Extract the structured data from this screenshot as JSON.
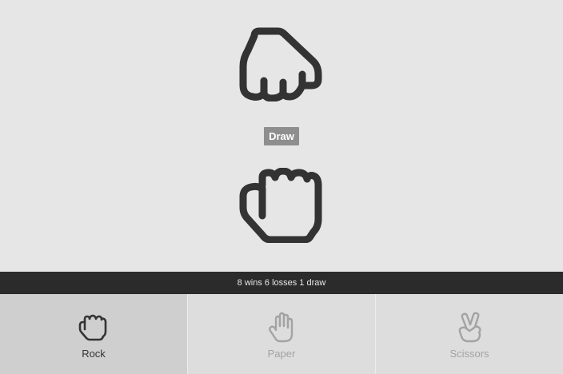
{
  "result": {
    "text": "Draw"
  },
  "cpu_hand": {
    "move": "rock",
    "icon": "rock-fist-icon"
  },
  "player_hand": {
    "move": "rock",
    "icon": "rock-fist-icon"
  },
  "score": {
    "text": "8 wins 6 losses 1 draw",
    "wins": 8,
    "losses": 6,
    "draws": 1
  },
  "choices": [
    {
      "label": "Rock",
      "icon": "rock-fist-icon",
      "selected": true
    },
    {
      "label": "Paper",
      "icon": "paper-hand-icon",
      "selected": false
    },
    {
      "label": "Scissors",
      "icon": "scissors-hand-icon",
      "selected": false
    }
  ],
  "colors": {
    "background": "#e6e6e6",
    "icon": "#333333",
    "icon_muted": "#a3a3a3",
    "badge": "#8e8e8e",
    "scorebar": "#2b2b2b",
    "tab": "#dddddd",
    "tab_selected": "#cfcfcf"
  }
}
